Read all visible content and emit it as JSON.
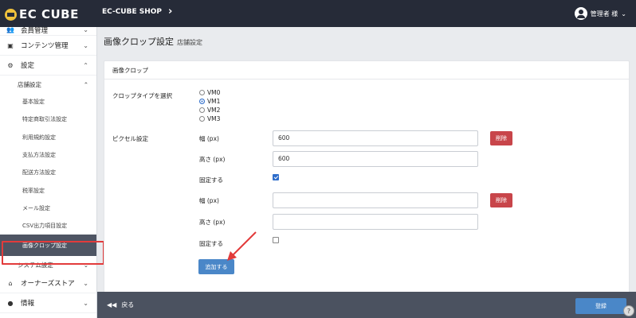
{
  "header": {
    "logo_text": "EC CUBE",
    "shop_name": "EC-CUBE SHOP",
    "shop_chevron": "›",
    "user_name": "管理者 様",
    "user_chevron": "⌄"
  },
  "sidebar": {
    "items": [
      {
        "icon": "👥",
        "label": "会員管理",
        "arrow": "⌄"
      },
      {
        "icon": "▣",
        "label": "コンテンツ管理",
        "arrow": "⌄"
      },
      {
        "icon": "⚙",
        "label": "設定",
        "arrow": "⌃"
      }
    ],
    "shop_settings": {
      "label": "店舗設定",
      "arrow": "⌃"
    },
    "shop_children": [
      "基本設定",
      "特定商取引法設定",
      "利用規約設定",
      "支払方法設定",
      "配送方法設定",
      "税率設定",
      "メール設定",
      "CSV出力項目設定",
      "画像クロップ設定"
    ],
    "system": {
      "label": "システム設定",
      "arrow": "⌄"
    },
    "bottom_items": [
      {
        "icon": "⌂",
        "label": "オーナーズストア",
        "arrow": "⌄"
      },
      {
        "icon": "●",
        "label": "情報",
        "arrow": "⌄"
      }
    ]
  },
  "page": {
    "title": "画像クロップ設定",
    "subtitle": "店舗設定"
  },
  "card": {
    "header": "画像クロップ",
    "crop_type_label": "クロップタイプを選択",
    "crop_types": [
      {
        "label": "VM0",
        "selected": false
      },
      {
        "label": "VM1",
        "selected": true
      },
      {
        "label": "VM2",
        "selected": false
      },
      {
        "label": "VM3",
        "selected": false
      }
    ],
    "pixel_label": "ピクセル設定",
    "groups": [
      {
        "width_label": "幅 (px)",
        "width_value": "600",
        "height_label": "高さ (px)",
        "height_value": "600",
        "fixed_label": "固定する",
        "fixed": true,
        "delete_label": "削除"
      },
      {
        "width_label": "幅 (px)",
        "width_value": "",
        "height_label": "高さ (px)",
        "height_value": "",
        "fixed_label": "固定する",
        "fixed": false,
        "delete_label": "削除"
      }
    ],
    "add_button": "追加する"
  },
  "footer": {
    "back_label": "戻る",
    "back_icon": "◀◀",
    "register_button": "登録"
  },
  "colors": {
    "accent": "#4a87c8",
    "danger": "#c8454a",
    "highlight": "#e23b3b",
    "topbar": "#262b38"
  }
}
